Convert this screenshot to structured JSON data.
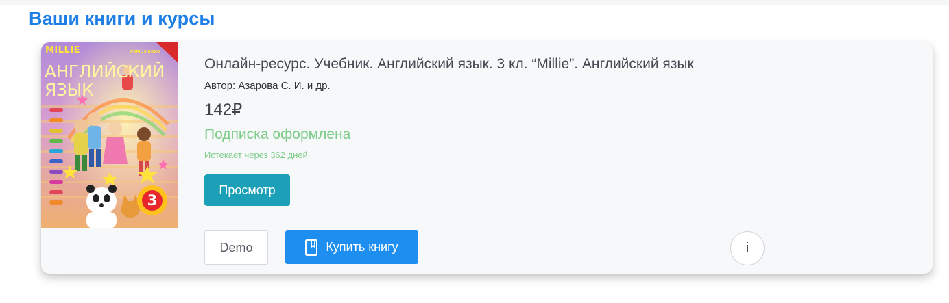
{
  "section": {
    "title": "Ваши книги и курсы"
  },
  "book": {
    "cover": {
      "series": "MILLIE",
      "edition": "PUPIL'S BOOK",
      "title_line1": "АНГЛИЙСКИЙ",
      "title_line2": "ЯЗЫК",
      "grade": "3"
    },
    "title": "Онлайн-ресурс. Учебник. Английский язык. 3 кл. “Millie”. Английский язык",
    "author": "Автор: Азарова С. И. и др.",
    "price": "142₽",
    "subscription_status": "Подписка оформлена",
    "subscription_expires": "Истекает через 362 дней"
  },
  "actions": {
    "view_label": "Просмотр",
    "demo_label": "Demo",
    "buy_label": "Купить книгу",
    "buy_icon": "book-icon",
    "info_label": "i"
  },
  "colors": {
    "accent_blue": "#1e7fe6",
    "teal_button": "#1ba0b8",
    "buy_button": "#1e8ef0",
    "status_green": "#7ccc8a",
    "card_background": "#f7f8fa"
  }
}
